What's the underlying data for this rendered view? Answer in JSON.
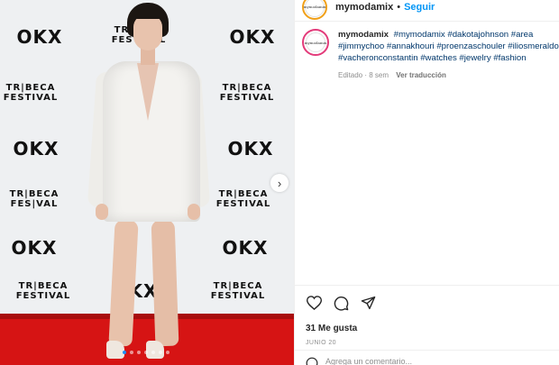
{
  "post": {
    "username": "mymodamix",
    "separator": "•",
    "follow_label": "Seguir",
    "avatar_text": "mymodamix",
    "caption_user": "mymodamix",
    "hashtags": [
      "#mymodamix",
      "#dakotajohnson",
      "#area",
      "#jimmychoo",
      "#annakhouri",
      "#proenzaschouler",
      "#iliosmeraldo",
      "#vacheronconstantin",
      "#watches",
      "#jewelry",
      "#fashion"
    ],
    "edited_label": "Editado · 8 sem",
    "translate_label": "Ver traducción",
    "likes_label": "31 Me gusta",
    "date_label": "JUNIO 20",
    "comment_placeholder": "Agrega un comentario..."
  },
  "backdrop": {
    "okx_logo": "OKX",
    "tribeca_line1": "TR|BECA",
    "tribeca_line2": "FESTIVAL",
    "tribeca_short1": "TR|BECA",
    "tribeca_short2": "FES|VAL"
  },
  "carousel": {
    "next_label": "›",
    "slide_count": 7,
    "active_index": 0
  },
  "colors": {
    "accent": "#0095f6",
    "carpet": "#d61414",
    "hashtag": "#00376b"
  }
}
